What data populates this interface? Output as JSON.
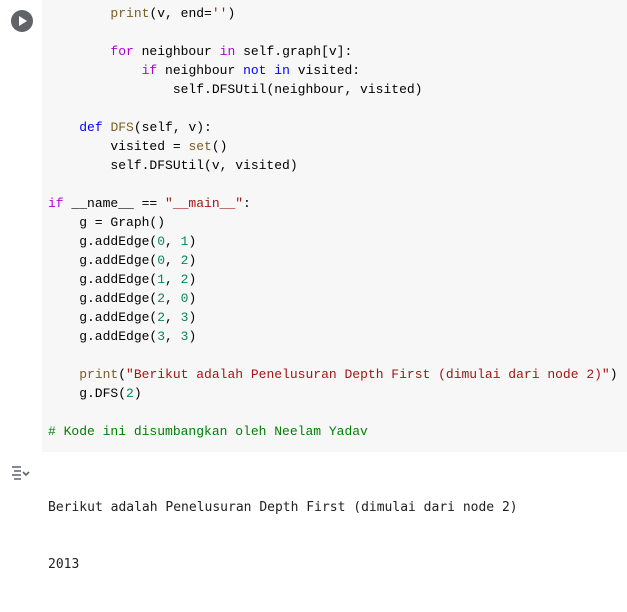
{
  "code_lines": [
    [
      {
        "t": "        ",
        "c": "txt"
      },
      {
        "t": "print",
        "c": "fn"
      },
      {
        "t": "(v, end=",
        "c": "txt"
      },
      {
        "t": "''",
        "c": "str"
      },
      {
        "t": ")",
        "c": "txt"
      }
    ],
    [],
    [
      {
        "t": "        ",
        "c": "txt"
      },
      {
        "t": "for",
        "c": "kw2"
      },
      {
        "t": " neighbour ",
        "c": "txt"
      },
      {
        "t": "in",
        "c": "kw2"
      },
      {
        "t": " self.graph[v]:",
        "c": "txt"
      }
    ],
    [
      {
        "t": "            ",
        "c": "txt"
      },
      {
        "t": "if",
        "c": "kw2"
      },
      {
        "t": " neighbour ",
        "c": "txt"
      },
      {
        "t": "not",
        "c": "kw"
      },
      {
        "t": " ",
        "c": "txt"
      },
      {
        "t": "in",
        "c": "kw"
      },
      {
        "t": " visited:",
        "c": "txt"
      }
    ],
    [
      {
        "t": "                ",
        "c": "txt"
      },
      {
        "t": "self.DFSUtil(neighbour, visited)",
        "c": "txt"
      }
    ],
    [],
    [
      {
        "t": "    ",
        "c": "txt"
      },
      {
        "t": "def",
        "c": "kw"
      },
      {
        "t": " ",
        "c": "txt"
      },
      {
        "t": "DFS",
        "c": "fn"
      },
      {
        "t": "(self, v):",
        "c": "txt"
      }
    ],
    [
      {
        "t": "        visited = ",
        "c": "txt"
      },
      {
        "t": "set",
        "c": "fn"
      },
      {
        "t": "()",
        "c": "txt"
      }
    ],
    [
      {
        "t": "        self.DFSUtil(v, visited)",
        "c": "txt"
      }
    ],
    [],
    [
      {
        "t": "if",
        "c": "kw2"
      },
      {
        "t": " __name__ == ",
        "c": "txt"
      },
      {
        "t": "\"__main__\"",
        "c": "str"
      },
      {
        "t": ":",
        "c": "txt"
      }
    ],
    [
      {
        "t": "    g = Graph()",
        "c": "txt"
      }
    ],
    [
      {
        "t": "    g.addEdge(",
        "c": "txt"
      },
      {
        "t": "0",
        "c": "num"
      },
      {
        "t": ", ",
        "c": "txt"
      },
      {
        "t": "1",
        "c": "num"
      },
      {
        "t": ")",
        "c": "txt"
      }
    ],
    [
      {
        "t": "    g.addEdge(",
        "c": "txt"
      },
      {
        "t": "0",
        "c": "num"
      },
      {
        "t": ", ",
        "c": "txt"
      },
      {
        "t": "2",
        "c": "num"
      },
      {
        "t": ")",
        "c": "txt"
      }
    ],
    [
      {
        "t": "    g.addEdge(",
        "c": "txt"
      },
      {
        "t": "1",
        "c": "num"
      },
      {
        "t": ", ",
        "c": "txt"
      },
      {
        "t": "2",
        "c": "num"
      },
      {
        "t": ")",
        "c": "txt"
      }
    ],
    [
      {
        "t": "    g.addEdge(",
        "c": "txt"
      },
      {
        "t": "2",
        "c": "num"
      },
      {
        "t": ", ",
        "c": "txt"
      },
      {
        "t": "0",
        "c": "num"
      },
      {
        "t": ")",
        "c": "txt"
      }
    ],
    [
      {
        "t": "    g.addEdge(",
        "c": "txt"
      },
      {
        "t": "2",
        "c": "num"
      },
      {
        "t": ", ",
        "c": "txt"
      },
      {
        "t": "3",
        "c": "num"
      },
      {
        "t": ")",
        "c": "txt"
      }
    ],
    [
      {
        "t": "    g.addEdge(",
        "c": "txt"
      },
      {
        "t": "3",
        "c": "num"
      },
      {
        "t": ", ",
        "c": "txt"
      },
      {
        "t": "3",
        "c": "num"
      },
      {
        "t": ")",
        "c": "txt"
      }
    ],
    [],
    [
      {
        "t": "    ",
        "c": "txt"
      },
      {
        "t": "print",
        "c": "fn"
      },
      {
        "t": "(",
        "c": "txt"
      },
      {
        "t": "\"Berikut adalah Penelusuran Depth First (dimulai dari node 2)\"",
        "c": "str"
      },
      {
        "t": ")",
        "c": "txt"
      }
    ],
    [
      {
        "t": "    g.DFS(",
        "c": "txt"
      },
      {
        "t": "2",
        "c": "num"
      },
      {
        "t": ")",
        "c": "txt"
      }
    ],
    [],
    [
      {
        "t": "# Kode ini disumbangkan oleh Neelam Yadav",
        "c": "cm"
      }
    ]
  ],
  "output_lines": [
    "Berikut adalah Penelusuran Depth First (dimulai dari node 2)",
    "2013"
  ],
  "icons": {
    "run": "run-cell-icon",
    "output": "output-toggle-icon"
  },
  "colors": {
    "editor_bg": "#f7f7f7",
    "keyword": "#0000ff",
    "control_keyword": "#af00db",
    "function": "#795e26",
    "number": "#098658",
    "string": "#a31515",
    "comment": "#008000"
  }
}
